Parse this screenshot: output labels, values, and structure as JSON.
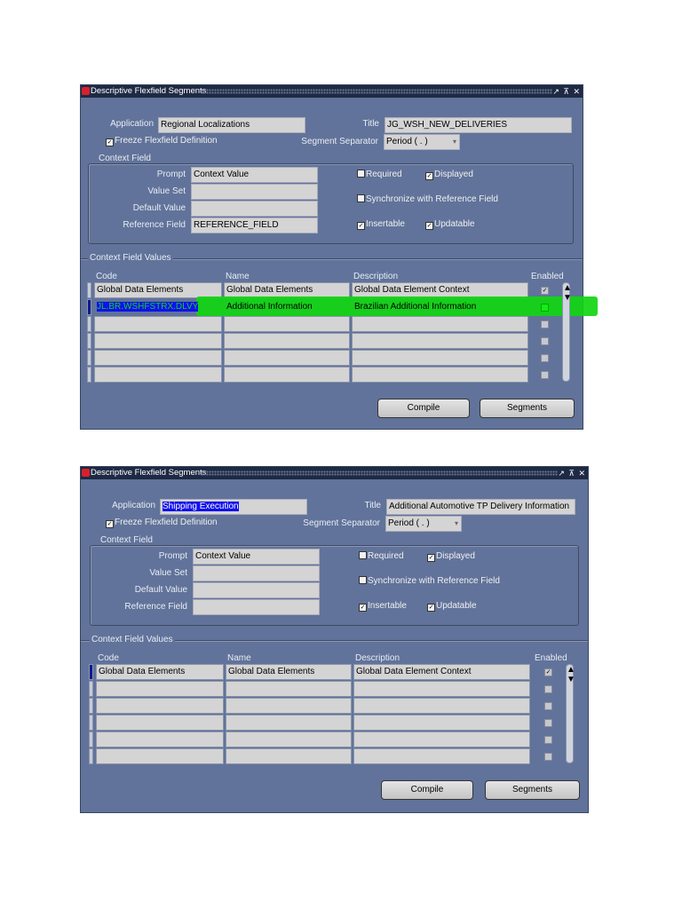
{
  "windows": [
    {
      "title": "Descriptive Flexfield Segments",
      "window_controls": "↗ ⊼ ✕",
      "application_label": "Application",
      "application_value": "Regional Localizations",
      "application_selected": false,
      "title_label": "Title",
      "title_value": "JG_WSH_NEW_DELIVERIES",
      "freeze_label": "Freeze Flexfield Definition",
      "freeze_checked": true,
      "separator_label": "Segment Separator",
      "separator_value": "Period ( . )",
      "context_field_group": "Context Field",
      "prompt_label": "Prompt",
      "prompt_value": "Context Value",
      "value_set_label": "Value Set",
      "value_set_value": "",
      "default_value_label": "Default Value",
      "default_value_value": "",
      "reference_field_label": "Reference Field",
      "reference_field_value": "REFERENCE_FIELD",
      "required_label": "Required",
      "required_checked": false,
      "displayed_label": "Displayed",
      "displayed_checked": true,
      "synchronize_label": "Synchronize with Reference Field",
      "synchronize_checked": false,
      "insertable_label": "Insertable",
      "insertable_checked": true,
      "updatable_label": "Updatable",
      "updatable_checked": true,
      "values_group": "Context Field Values",
      "columns": [
        "Code",
        "Name",
        "Description",
        "Enabled"
      ],
      "rows": [
        {
          "code": "Global Data Elements",
          "name": "Global Data Elements",
          "description": "Global Data Element Context",
          "enabled": true
        },
        {
          "code": "JL.BR.WSHFSTRX.DLVY",
          "name": "Additional Information",
          "description": "Brazilian Additional Information",
          "enabled": true,
          "highlighted": true,
          "current": true
        },
        {
          "code": "",
          "name": "",
          "description": "",
          "enabled": false
        },
        {
          "code": "",
          "name": "",
          "description": "",
          "enabled": false
        },
        {
          "code": "",
          "name": "",
          "description": "",
          "enabled": false
        },
        {
          "code": "",
          "name": "",
          "description": "",
          "enabled": false
        }
      ],
      "compile_label": "Compile",
      "segments_label": "Segments",
      "highlight_color": "#11d611"
    },
    {
      "title": "Descriptive Flexfield Segments",
      "window_controls": "↗ ⊼ ✕",
      "application_label": "Application",
      "application_value": "Shipping Execution",
      "application_selected": true,
      "title_label": "Title",
      "title_value": "Additional Automotive TP Delivery Information",
      "freeze_label": "Freeze Flexfield Definition",
      "freeze_checked": true,
      "separator_label": "Segment Separator",
      "separator_value": "Period ( . )",
      "context_field_group": "Context Field",
      "prompt_label": "Prompt",
      "prompt_value": "Context Value",
      "value_set_label": "Value Set",
      "value_set_value": "",
      "default_value_label": "Default Value",
      "default_value_value": "",
      "reference_field_label": "Reference Field",
      "reference_field_value": "",
      "required_label": "Required",
      "required_checked": false,
      "displayed_label": "Displayed",
      "displayed_checked": true,
      "synchronize_label": "Synchronize with Reference Field",
      "synchronize_checked": false,
      "insertable_label": "Insertable",
      "insertable_checked": true,
      "updatable_label": "Updatable",
      "updatable_checked": true,
      "values_group": "Context Field Values",
      "columns": [
        "Code",
        "Name",
        "Description",
        "Enabled"
      ],
      "rows": [
        {
          "code": "Global Data Elements",
          "name": "Global Data Elements",
          "description": "Global Data Element Context",
          "enabled": true,
          "current": true
        },
        {
          "code": "",
          "name": "",
          "description": "",
          "enabled": false
        },
        {
          "code": "",
          "name": "",
          "description": "",
          "enabled": false
        },
        {
          "code": "",
          "name": "",
          "description": "",
          "enabled": false
        },
        {
          "code": "",
          "name": "",
          "description": "",
          "enabled": false
        },
        {
          "code": "",
          "name": "",
          "description": "",
          "enabled": false
        }
      ],
      "compile_label": "Compile",
      "segments_label": "Segments"
    }
  ]
}
